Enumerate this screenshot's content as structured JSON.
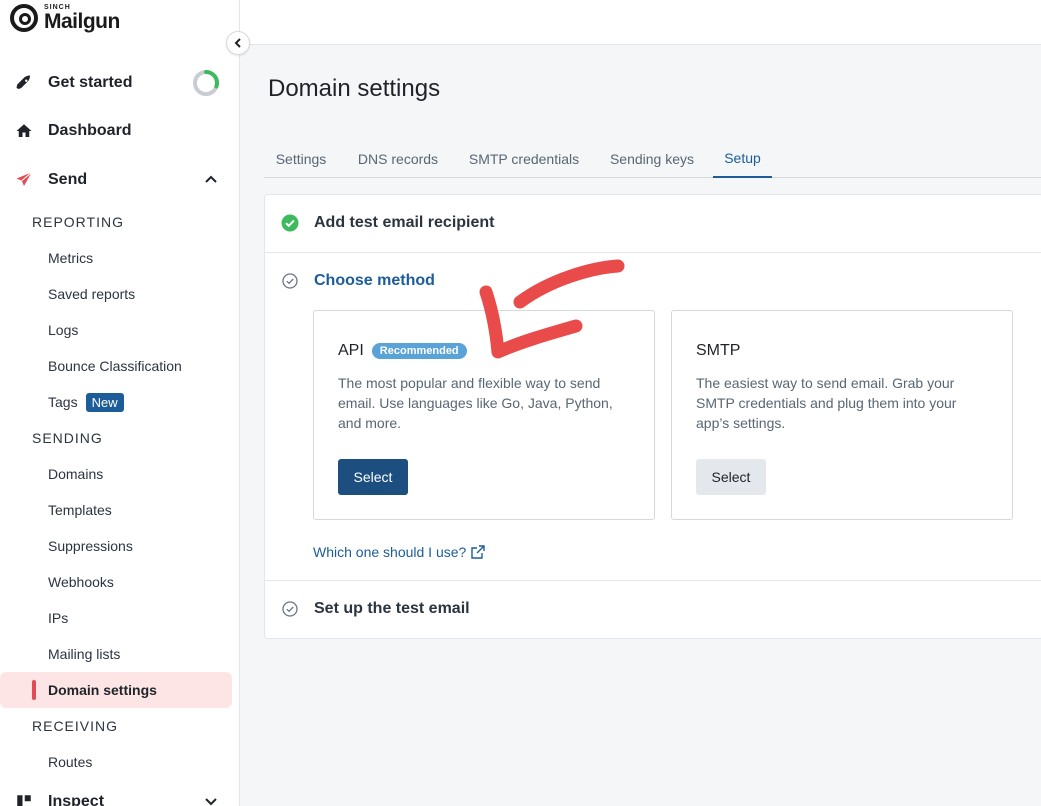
{
  "brand": {
    "sup": "SINCH",
    "name": "Mailgun"
  },
  "sidebar": {
    "top": [
      {
        "label": "Get started",
        "icon": "rocket-icon"
      },
      {
        "label": "Dashboard",
        "icon": "home-icon"
      },
      {
        "label": "Send",
        "icon": "send-icon"
      }
    ],
    "reporting_header": "REPORTING",
    "reporting": [
      "Metrics",
      "Saved reports",
      "Logs",
      "Bounce Classification",
      "Tags"
    ],
    "tags_badge": "New",
    "sending_header": "SENDING",
    "sending": [
      "Domains",
      "Templates",
      "Suppressions",
      "Webhooks",
      "IPs",
      "Mailing lists",
      "Domain settings"
    ],
    "receiving_header": "RECEIVING",
    "receiving": [
      "Routes"
    ],
    "inspect_label": "Inspect",
    "get_started_progress": 0.3
  },
  "page": {
    "title": "Domain settings",
    "tabs": [
      "Settings",
      "DNS records",
      "SMTP credentials",
      "Sending keys",
      "Setup"
    ],
    "active_tab": "Setup"
  },
  "steps": {
    "step1": "Add test email recipient",
    "step2": "Choose method",
    "step3": "Set up the test email"
  },
  "cards": {
    "api": {
      "title": "API",
      "badge": "Recommended",
      "desc": "The most popular and flexible way to send email. Use languages like Go, Java, Python, and more.",
      "button": "Select"
    },
    "smtp": {
      "title": "SMTP",
      "desc": "The easiest way to send email. Grab your SMTP credentials and plug them into your app’s settings.",
      "button": "Select"
    }
  },
  "help_link": "Which one should I use?",
  "colors": {
    "accent": "#1c5d99",
    "active_bg": "#fde5e6",
    "active_bar": "#e04b55",
    "success": "#3dba5c",
    "annotation": "#e94b4b"
  }
}
